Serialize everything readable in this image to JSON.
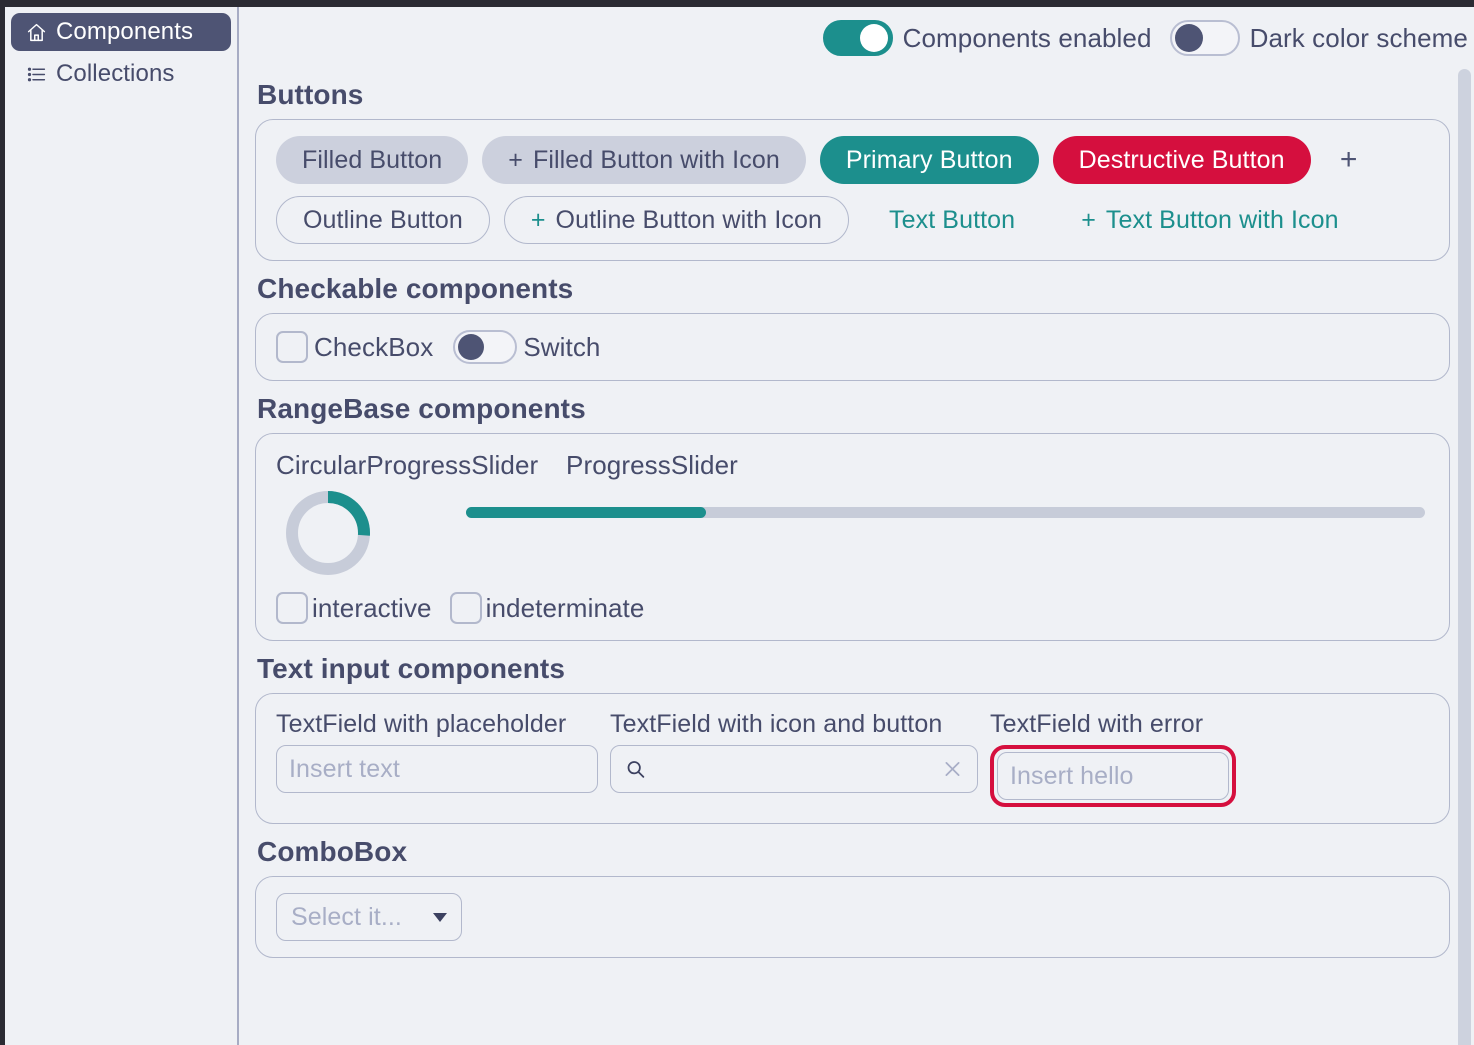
{
  "sidebar": {
    "items": [
      {
        "label": "Components",
        "icon": "home-icon",
        "active": true
      },
      {
        "label": "Collections",
        "icon": "list-icon",
        "active": false
      }
    ]
  },
  "toolbar": {
    "components_enabled": {
      "label": "Components enabled",
      "state": "on"
    },
    "dark_color_scheme": {
      "label": "Dark color scheme",
      "state": "off"
    }
  },
  "sections": {
    "buttons": {
      "title": "Buttons",
      "row1": [
        {
          "label": "Filled Button",
          "style": "filled",
          "icon": ""
        },
        {
          "label": "Filled Button with Icon",
          "style": "filled",
          "icon": "+"
        },
        {
          "label": "Primary Button",
          "style": "primary",
          "icon": ""
        },
        {
          "label": "Destructive Button",
          "style": "destructive",
          "icon": ""
        },
        {
          "label": "+",
          "style": "icon-only",
          "icon": "+"
        }
      ],
      "row2": [
        {
          "label": "Outline Button",
          "style": "outline",
          "icon": ""
        },
        {
          "label": "Outline Button with Icon",
          "style": "outline",
          "icon": "+"
        },
        {
          "label": "Text Button",
          "style": "text",
          "icon": ""
        },
        {
          "label": "Text Button with Icon",
          "style": "text",
          "icon": "+"
        }
      ]
    },
    "checkable": {
      "title": "Checkable components",
      "checkbox": {
        "label": "CheckBox",
        "checked": false
      },
      "switch": {
        "label": "Switch",
        "state": "off"
      }
    },
    "rangebase": {
      "title": "RangeBase components",
      "circular_label": "CircularProgressSlider",
      "progress_label": "ProgressSlider",
      "circular_value_percent": 26,
      "progress_value_percent": 25,
      "interactive": {
        "label": "interactive",
        "checked": false
      },
      "indeterminate": {
        "label": "indeterminate",
        "checked": false
      }
    },
    "textinput": {
      "title": "Text input components",
      "placeholder_field": {
        "caption": "TextField with placeholder",
        "placeholder": "Insert text",
        "value": ""
      },
      "icon_field": {
        "caption": "TextField with icon and button",
        "placeholder": "",
        "value": "",
        "leading_icon": "search-icon",
        "trailing_icon": "clear-icon"
      },
      "error_field": {
        "caption": "TextField with error",
        "placeholder": "Insert hello",
        "value": "",
        "error": true
      }
    },
    "combobox": {
      "title": "ComboBox",
      "value": "Select it...",
      "options": [
        "Select it..."
      ]
    }
  },
  "colors": {
    "accent_teal": "#1c8f8d",
    "destructive_red": "#d50f3e",
    "text_primary": "#474c6b",
    "nav_active_bg": "#4e5474",
    "surface_bg": "#eff1f5",
    "border": "#b2b8cc",
    "placeholder": "#a8aec6"
  }
}
